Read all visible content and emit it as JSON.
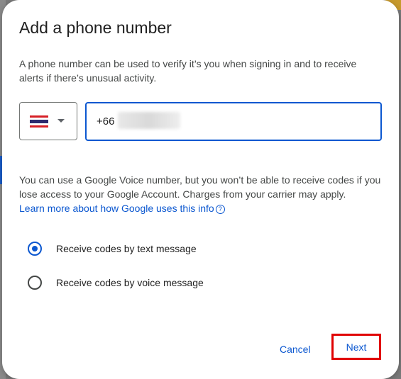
{
  "dialog": {
    "title": "Add a phone number",
    "description": "A phone number can be used to verify it’s you when signing in and to receive alerts if there’s unusual activity."
  },
  "phone": {
    "country_flag": "thailand-flag-icon",
    "country_code": "+66",
    "value_redacted": true
  },
  "note": {
    "text": "You can use a Google Voice number, but you won’t be able to receive codes if you lose access to your Google Account. Charges from your carrier may apply.",
    "link_text": "Learn more about how Google uses this info",
    "link_icon": "help-circle-icon"
  },
  "options": [
    {
      "label": "Receive codes by text message",
      "selected": true
    },
    {
      "label": "Receive codes by voice message",
      "selected": false
    }
  ],
  "actions": {
    "cancel_label": "Cancel",
    "next_label": "Next"
  },
  "colors": {
    "accent": "#0b57d0",
    "highlight_box": "#e00000"
  }
}
